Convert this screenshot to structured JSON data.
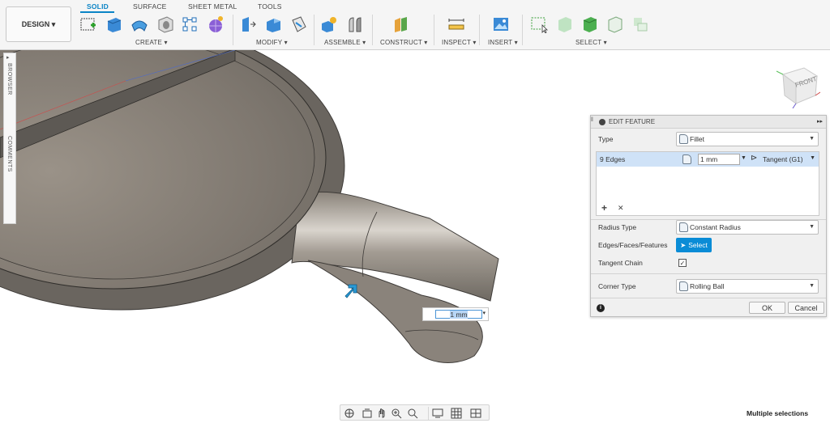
{
  "toolbar": {
    "workspace": "DESIGN ▾",
    "tabs": [
      "SOLID",
      "SURFACE",
      "SHEET METAL",
      "TOOLS"
    ],
    "groups": [
      "CREATE ▾",
      "MODIFY ▾",
      "ASSEMBLE ▾",
      "CONSTRUCT ▾",
      "INSPECT ▾",
      "INSERT ▾",
      "SELECT ▾"
    ]
  },
  "side": {
    "browser": "BROWSER",
    "comments": "COMMENTS"
  },
  "viewcube": {
    "face": "FRONT"
  },
  "panel": {
    "title": "EDIT FEATURE",
    "type_label": "Type",
    "type_value": "Fillet",
    "edges_label": "9 Edges",
    "radius": "1 mm",
    "tangency": "Tangent (G1)",
    "add": "+",
    "remove": "✕",
    "radius_type_label": "Radius Type",
    "radius_type_value": "Constant Radius",
    "efc_label": "Edges/Faces/Features",
    "select_label": "Select",
    "tangent_chain_label": "Tangent Chain",
    "tangent_chain_checked": true,
    "corner_type_label": "Corner Type",
    "corner_type_value": "Rolling Ball",
    "ok": "OK",
    "cancel": "Cancel"
  },
  "canvas_input": "1 mm",
  "status": "Multiple selections",
  "colors": {
    "accent": "#0a84c6",
    "select": "#0a8cd6",
    "model": "#8a8278"
  }
}
